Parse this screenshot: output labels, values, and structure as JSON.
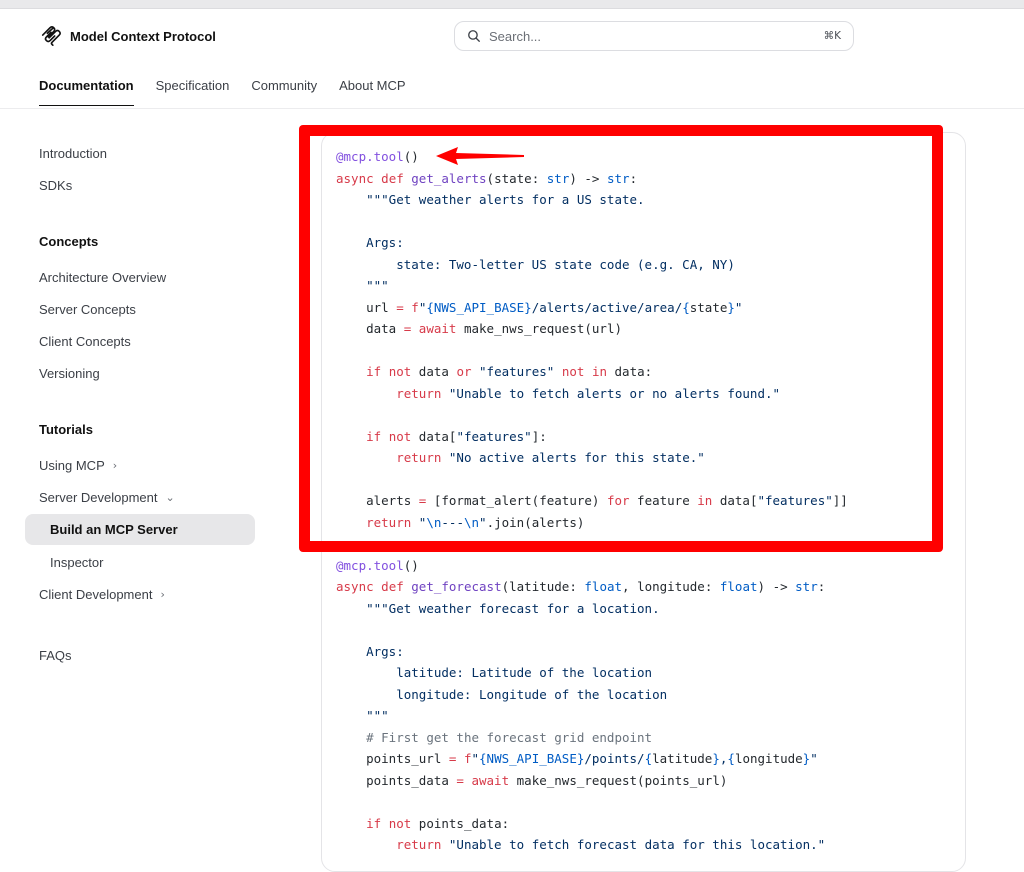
{
  "brand": {
    "name": "Model Context Protocol"
  },
  "search": {
    "placeholder": "Search...",
    "shortcut": "⌘K"
  },
  "tabs": [
    {
      "label": "Documentation",
      "active": true
    },
    {
      "label": "Specification"
    },
    {
      "label": "Community"
    },
    {
      "label": "About MCP"
    }
  ],
  "sidebar": {
    "intro": "Introduction",
    "sdks": "SDKs",
    "concepts_heading": "Concepts",
    "concepts": [
      "Architecture Overview",
      "Server Concepts",
      "Client Concepts",
      "Versioning"
    ],
    "tutorials_heading": "Tutorials",
    "using_mcp": "Using MCP",
    "server_dev": "Server Development",
    "build_server": "Build an MCP Server",
    "inspector": "Inspector",
    "client_dev": "Client Development",
    "faqs": "FAQs"
  },
  "code": {
    "language": "python",
    "highlighted_line": "@mcp.tool()"
  },
  "colors": {
    "highlight": "#ff0000",
    "active_bg": "#e7e7e9"
  }
}
